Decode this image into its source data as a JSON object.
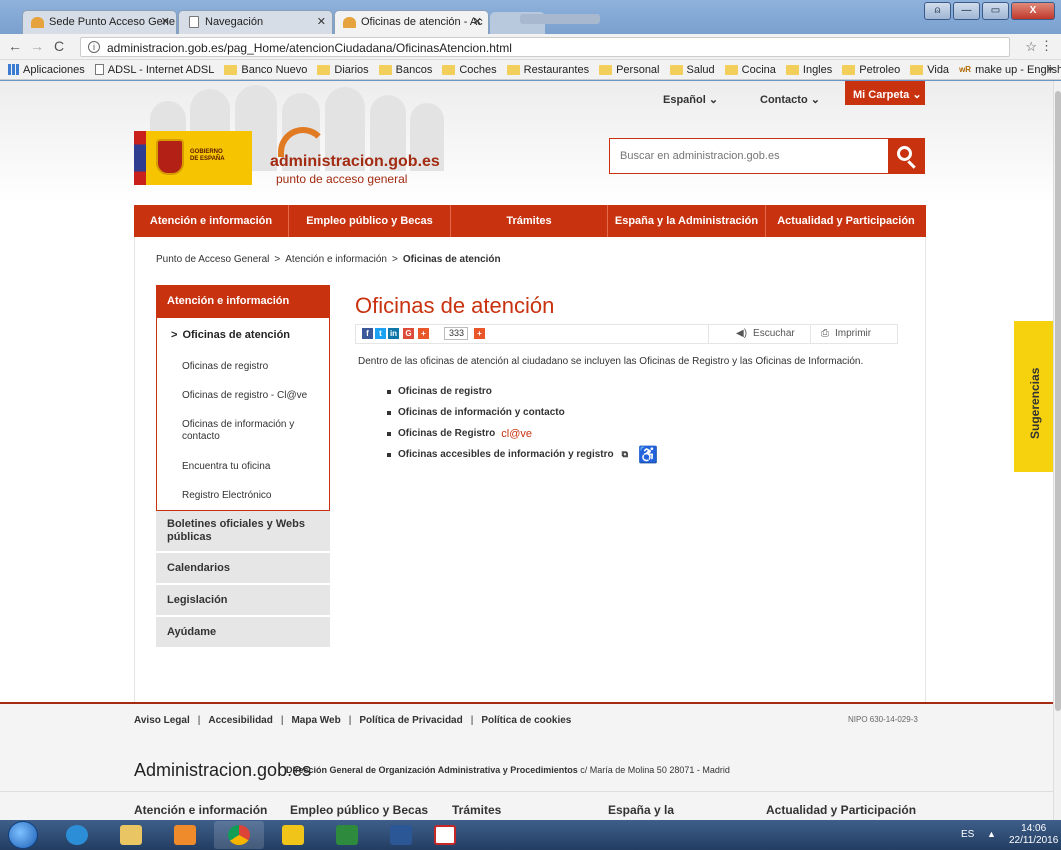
{
  "browser": {
    "tabs": [
      {
        "label": "Sede Punto Acceso Gene",
        "active": false
      },
      {
        "label": "Navegación",
        "active": false
      },
      {
        "label": "Oficinas de atención - Ac",
        "active": true
      }
    ],
    "url": "administracion.gob.es/pag_Home/atencionCiudadana/OficinasAtencion.html",
    "bookmarks": [
      {
        "label": "Aplicaciones",
        "icon": "apps-grid-icon"
      },
      {
        "label": "ADSL - Internet ADSL",
        "icon": "page-icon"
      },
      {
        "label": "Banco Nuevo",
        "icon": "folder-icon"
      },
      {
        "label": "Diarios",
        "icon": "folder-icon"
      },
      {
        "label": "Bancos",
        "icon": "folder-icon"
      },
      {
        "label": "Coches",
        "icon": "folder-icon"
      },
      {
        "label": "Restaurantes",
        "icon": "folder-icon"
      },
      {
        "label": "Personal",
        "icon": "folder-icon"
      },
      {
        "label": "Salud",
        "icon": "folder-icon"
      },
      {
        "label": "Cocina",
        "icon": "folder-icon"
      },
      {
        "label": "Ingles",
        "icon": "folder-icon"
      },
      {
        "label": "Petroleo",
        "icon": "folder-icon"
      },
      {
        "label": "Vida",
        "icon": "folder-icon"
      },
      {
        "label": "make up - English-Sp",
        "icon": "wr-icon"
      }
    ],
    "more_bookmarks": "»"
  },
  "header": {
    "language": "Español",
    "contact": "Contacto",
    "my_folder": "Mi Carpeta",
    "gov_logo_text": "GOBIERNO DE ESPAÑA",
    "site_name": "administracion.gob.es",
    "site_tagline": "punto de acceso general",
    "search_placeholder": "Buscar en administracion.gob.es"
  },
  "main_nav": [
    "Atención e información",
    "Empleo público y Becas",
    "Trámites",
    "España y la Administración",
    "Actualidad y Participación"
  ],
  "breadcrumb": {
    "items": [
      "Punto de Acceso General",
      "Atención e información"
    ],
    "separator": ">",
    "current": "Oficinas de atención"
  },
  "sidebar": {
    "section": "Atención e información",
    "active_item": "Oficinas de atención",
    "active_marker": ">",
    "sub_items": [
      "Oficinas de registro",
      "Oficinas de registro - Cl@ve",
      "Oficinas de información y contacto",
      "Encuentra tu oficina",
      "Registro Electrónico"
    ],
    "other_sections": [
      "Boletines oficiales y Webs públicas",
      "Calendarios",
      "Legislación",
      "Ayúdame"
    ]
  },
  "content": {
    "title": "Oficinas de atención",
    "share_count": "333",
    "listen": "Escuchar",
    "print": "Imprimir",
    "intro": "Dentro de las oficinas de atención al ciudadano se incluyen las Oficinas de Registro y las Oficinas de Información.",
    "links": [
      {
        "label": "Oficinas de registro"
      },
      {
        "label": "Oficinas de información y contacto"
      },
      {
        "label": "Oficinas de Registro",
        "suffix": "cl@ve"
      },
      {
        "label": "Oficinas accesibles de información y registro"
      }
    ]
  },
  "feedback_tab": "Sugerencias",
  "footer": {
    "links": [
      "Aviso Legal",
      "Accesibilidad",
      "Mapa Web",
      "Política de Privacidad",
      "Política de cookies"
    ],
    "nipo": "NIPO 630-14-029-3",
    "brand": "Administracion.gob.es",
    "org": "Dirección General de Organización Administrativa y Procedimientos",
    "address": "c/ María de Molina 50 28071 - Madrid",
    "nav": [
      "Atención e información",
      "Empleo público y Becas",
      "Trámites",
      "España y la",
      "Actualidad y Participación"
    ]
  },
  "taskbar": {
    "language": "ES",
    "time": "14:06",
    "date": "22/11/2016"
  },
  "colors": {
    "brand_red": "#c8320f",
    "feedback_yellow": "#f5d10e",
    "gov_yellow": "#f6c400"
  }
}
